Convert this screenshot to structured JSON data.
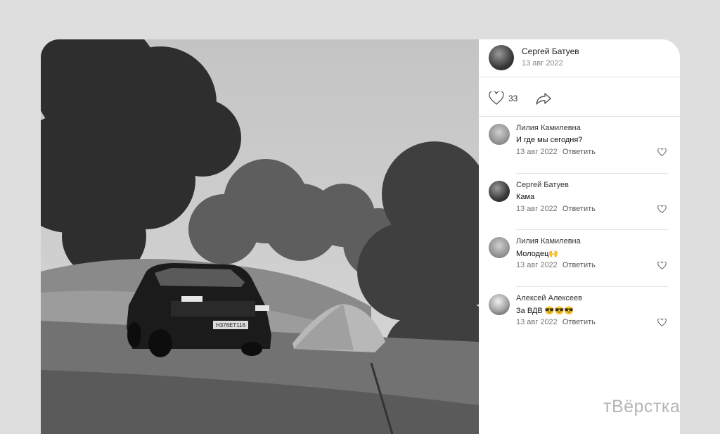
{
  "post": {
    "author": "Сергей Батуев",
    "date": "13 авг 2022",
    "likes": "33",
    "like_icon": "heart-icon",
    "share_icon": "share-icon"
  },
  "comments": [
    {
      "author": "Лилия Камилевна",
      "text": "И где мы сегодня?",
      "date": "13 авг 2022",
      "reply": "Ответить"
    },
    {
      "author": "Сергей Батуев",
      "text": "Кама",
      "date": "13 авг 2022",
      "reply": "Ответить"
    },
    {
      "author": "Лилия Камилевна",
      "text": "Молодец🙌",
      "date": "13 авг 2022",
      "reply": "Ответить"
    },
    {
      "author": "Алексей Алексеев",
      "text": "За ВДВ 😎😎😎",
      "date": "13 авг 2022",
      "reply": "Ответить"
    }
  ],
  "photo": {
    "plate": "Н376ЕТ116"
  },
  "watermark": "тВёрстка"
}
